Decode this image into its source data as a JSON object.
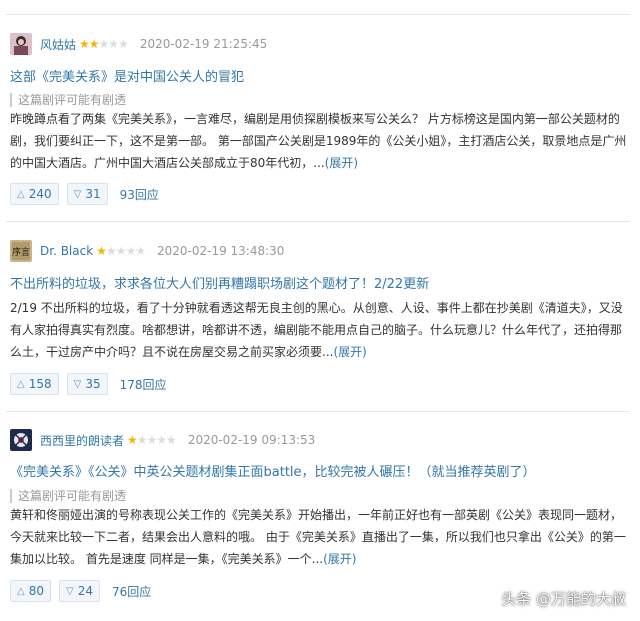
{
  "colors": {
    "link": "#3377aa",
    "star_on": "#f5b50a",
    "star_off": "#dcdcdc",
    "meta": "#999999"
  },
  "reviews": [
    {
      "author": "风姑姑",
      "rating": 2,
      "date": "2020-02-19 21:25:45",
      "title": "这部《完美关系》是对中国公关人的冒犯",
      "spoiler": "这篇剧评可能有剧透",
      "lines": [
        "昨晚蹲点看了两集《完美关系》，一言难尽，编剧是用侦探剧模板来写公关么？ 片方标榜这是国内第一部公关题材的",
        "剧，我们要纠正一下，这不是第一部。 第一部国产公关剧是1989年的《公关小姐》，主打酒店公关，取景地点是广州",
        "的中国大酒店。广州中国大酒店公关部成立于80年代初，..."
      ],
      "expand": "(展开)",
      "up": "240",
      "down": "31",
      "replies": "93回应"
    },
    {
      "author": "Dr. Black",
      "rating": 1,
      "date": "2020-02-19 13:48:30",
      "title": "不出所料的垃圾，求求各位大人们别再糟蹋职场剧这个题材了！2/22更新",
      "spoiler": "",
      "lines": [
        "2/19 不出所料的垃圾，看了十分钟就看透这帮无良主创的黑心。从创意、人设、事件上都在抄美剧《清道夫》，又没",
        "有人家拍得真实有烈度。啥都想讲，啥都讲不透，编剧能不能用点自己的脑子。什么玩意儿？什么年代了，还拍得那",
        "么土，干过房产中介吗？且不说在房屋交易之前买家必须要..."
      ],
      "expand": "(展开)",
      "up": "158",
      "down": "35",
      "replies": "178回应"
    },
    {
      "author": "西西里的朗读者",
      "rating": 1,
      "date": "2020-02-19 09:13:53",
      "title": "《完美关系》《公关》中英公关题材剧集正面battle，比较完被人碾压！（就当推荐英剧了）",
      "spoiler": "这篇剧评可能有剧透",
      "lines": [
        "黄轩和佟丽娅出演的号称表现公关工作的《完美关系》开始播出，一年前正好也有一部英剧《公关》表现同一题材，",
        "今天就来比较一下二者，结果会出人意料的哦。 由于《完美关系》直播出了一集，所以我们也只拿出《公关》的第一",
        "集加以比较。 首先是速度 同样是一集，《完美关系》一个..."
      ],
      "expand": "(展开)",
      "up": "80",
      "down": "24",
      "replies": "76回应"
    }
  ],
  "watermark": "头条 @万能的大叔"
}
